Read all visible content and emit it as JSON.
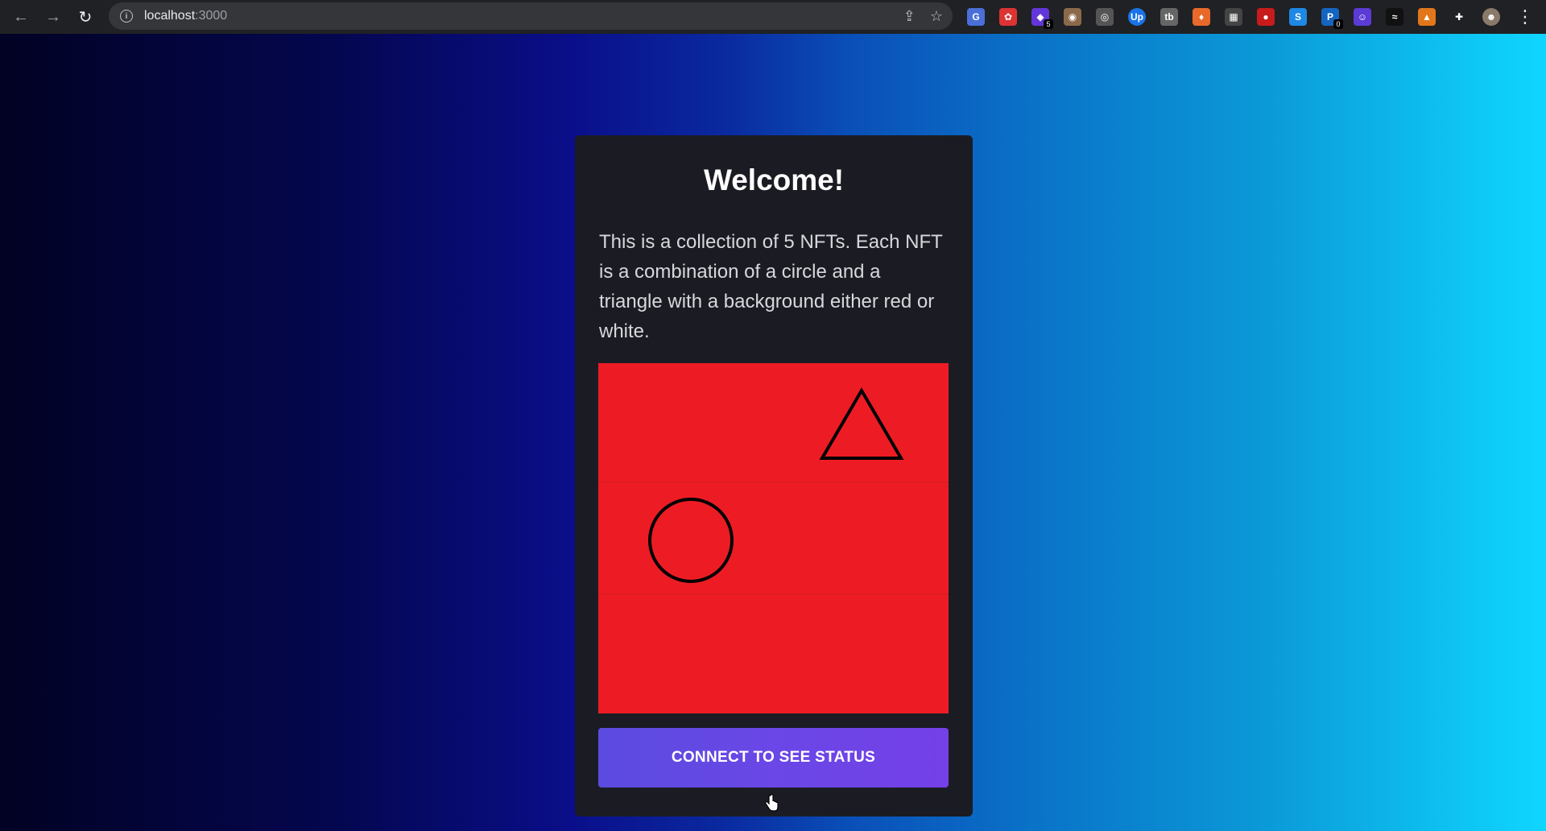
{
  "browser": {
    "url_host": "localhost",
    "url_port": ":3000",
    "nav": {
      "back_icon": "←",
      "forward_icon": "→",
      "reload_icon": "↻"
    },
    "extensions": [
      {
        "name": "translate-ext",
        "glyph": "G",
        "color": "#4a6fd8"
      },
      {
        "name": "ext-red",
        "glyph": "✿",
        "color": "#d33"
      },
      {
        "name": "ext-purple",
        "glyph": "◆",
        "color": "#6236d9",
        "badge": "5"
      },
      {
        "name": "ext-owl",
        "glyph": "◉",
        "color": "#8a6a4a"
      },
      {
        "name": "ext-target",
        "glyph": "◎",
        "color": "#555"
      },
      {
        "name": "ext-up",
        "glyph": "Up",
        "color": "#1a73e8"
      },
      {
        "name": "ext-tb",
        "glyph": "tb",
        "color": "#666"
      },
      {
        "name": "ext-orange",
        "glyph": "♦",
        "color": "#e8692a"
      },
      {
        "name": "ext-qr",
        "glyph": "▦",
        "color": "#444"
      },
      {
        "name": "ext-ladybug",
        "glyph": "●",
        "color": "#c81b1b"
      },
      {
        "name": "ext-s",
        "glyph": "S",
        "color": "#1e88e5"
      },
      {
        "name": "ext-p",
        "glyph": "P",
        "color": "#1565c0",
        "badge": "0"
      },
      {
        "name": "ext-ghost",
        "glyph": "☺",
        "color": "#5a3bd6"
      },
      {
        "name": "ext-wave",
        "glyph": "≈",
        "color": "#111"
      },
      {
        "name": "ext-fox",
        "glyph": "▲",
        "color": "#e2761b"
      },
      {
        "name": "puzzle",
        "glyph": "✚",
        "color": "#202124"
      },
      {
        "name": "profile",
        "glyph": "☻",
        "color": "#8a7a6a"
      }
    ]
  },
  "card": {
    "title": "Welcome!",
    "description": "This is a collection of 5 NFTs. Each NFT is a combination of a circle and a triangle with a background either red or white.",
    "nft": {
      "background": "#ed1c24",
      "shapes": [
        "triangle",
        "circle"
      ]
    },
    "cta_label": "CONNECT TO SEE STATUS"
  }
}
